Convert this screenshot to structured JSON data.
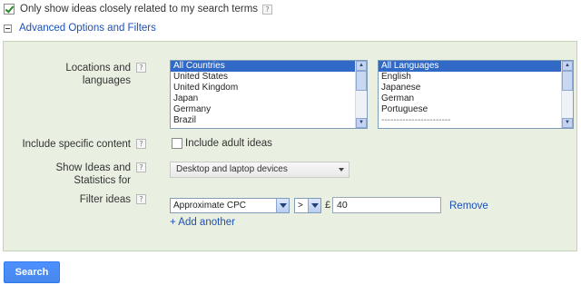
{
  "top_option": {
    "label": "Only show ideas closely related to my search terms",
    "checked": true,
    "help_icon": "?"
  },
  "advanced": {
    "toggle_symbol": "minus",
    "label": "Advanced Options and Filters"
  },
  "locations": {
    "label": "Locations and languages",
    "help_icon": "?",
    "countries": [
      "All Countries",
      "United States",
      "United Kingdom",
      "Japan",
      "Germany",
      "Brazil"
    ],
    "selected_country": "All Countries",
    "languages": [
      "All Languages",
      "English",
      "Japanese",
      "German",
      "Portuguese",
      "-----------------------"
    ],
    "selected_language": "All Languages"
  },
  "content": {
    "label": "Include specific content",
    "help_icon": "?",
    "checkbox_label": "Include adult ideas",
    "checked": false
  },
  "show_ideas": {
    "label": "Show Ideas and Statistics for",
    "help_icon": "?",
    "value": "Desktop and laptop devices"
  },
  "filter": {
    "label": "Filter ideas",
    "help_icon": "?",
    "metric": "Approximate CPC",
    "operator": ">",
    "currency": "£",
    "value": "40",
    "remove_label": "Remove",
    "add_label": "+ Add another"
  },
  "search_button": {
    "label": "Search"
  },
  "colors": {
    "panel_bg": "#e9f0e1",
    "link": "#1d4fb7",
    "selection": "#3169c6",
    "button": "#4d90fe"
  }
}
